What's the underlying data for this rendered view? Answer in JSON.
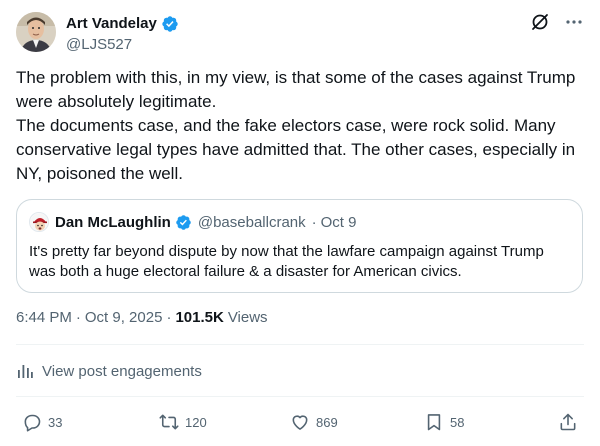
{
  "author": {
    "display_name": "Art Vandelay",
    "handle": "@LJS527"
  },
  "tweet": {
    "paragraphs": [
      "The problem with this, in my view, is that some of the cases against Trump were absolutely legitimate.",
      "The documents case, and the fake electors case, were rock solid. Many conservative legal types have admitted that. The other cases, especially in NY, poisoned the well."
    ]
  },
  "quote": {
    "display_name": "Dan McLaughlin",
    "handle": "@baseballcrank",
    "separator": "·",
    "date": "Oct 9",
    "text": "It's pretty far beyond dispute by now that the lawfare campaign against Trump was both a huge electoral failure & a disaster for American civics."
  },
  "meta": {
    "time": "6:44 PM",
    "separator1": "·",
    "date": "Oct 9, 2025",
    "separator2": "·",
    "views_count": "101.5K",
    "views_label": "Views"
  },
  "engagements": {
    "label": "View post engagements"
  },
  "actions": {
    "replies": "33",
    "reposts": "120",
    "likes": "869",
    "bookmarks": "58"
  },
  "colors": {
    "text": "#0f1419",
    "muted": "#536471",
    "verified": "#1d9bf0",
    "border": "#cfd9de"
  },
  "icons": [
    "verified-badge-icon",
    "grok-icon",
    "more-icon",
    "analytics-icon",
    "reply-icon",
    "repost-icon",
    "like-icon",
    "bookmark-icon",
    "share-icon"
  ]
}
